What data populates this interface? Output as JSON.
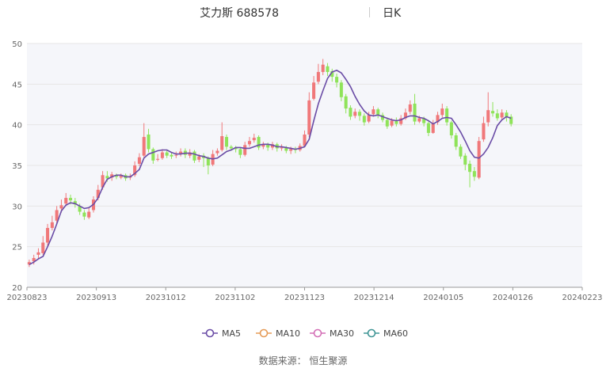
{
  "header": {
    "title": "艾力斯 688578",
    "period": "日K"
  },
  "source": "数据来源： 恒生聚源",
  "colors": {
    "up": "#f0787a",
    "down": "#8fe35a",
    "ma5": "#6a4ca6",
    "ma10": "#e59b57",
    "ma30": "#d36fb6",
    "ma60": "#3f9595",
    "plot_bg": "#f5f6fa",
    "grid": "#e6e6e6"
  },
  "chart_data": {
    "type": "candlestick",
    "title": "艾力斯 688578",
    "ylim": [
      20,
      50
    ],
    "yticks": [
      "20",
      "25",
      "30",
      "35",
      "40",
      "45",
      "50"
    ],
    "x_ticks": [
      "20230823",
      "20230913",
      "20231012",
      "20231102",
      "20231123",
      "20231214",
      "20240105",
      "20240126",
      "20240223"
    ],
    "n_days": 121,
    "legend": {
      "placement": "bottom",
      "entries": [
        "MA5",
        "MA10",
        "MA30",
        "MA60"
      ]
    },
    "candles": [
      [
        22.8,
        23.1,
        22.5,
        23.4
      ],
      [
        23.2,
        23.6,
        22.8,
        24.0
      ],
      [
        24.0,
        24.3,
        23.5,
        24.8
      ],
      [
        24.2,
        25.5,
        24.0,
        26.3
      ],
      [
        25.5,
        27.3,
        25.0,
        27.8
      ],
      [
        27.3,
        28.0,
        27.0,
        28.8
      ],
      [
        28.2,
        29.5,
        27.8,
        30.0
      ],
      [
        29.7,
        30.1,
        29.2,
        30.8
      ],
      [
        30.3,
        31.0,
        30.0,
        31.6
      ],
      [
        31.0,
        30.7,
        30.2,
        31.4
      ],
      [
        30.6,
        30.2,
        29.8,
        31.0
      ],
      [
        30.0,
        29.3,
        28.9,
        30.3
      ],
      [
        29.2,
        28.7,
        28.3,
        29.5
      ],
      [
        28.6,
        29.3,
        28.4,
        29.8
      ],
      [
        29.5,
        30.8,
        29.2,
        31.2
      ],
      [
        31.0,
        32.0,
        30.7,
        32.6
      ],
      [
        32.3,
        33.8,
        32.0,
        34.3
      ],
      [
        33.7,
        33.4,
        33.0,
        34.3
      ],
      [
        33.5,
        33.9,
        33.1,
        34.2
      ],
      [
        33.8,
        33.6,
        33.3,
        34.0
      ],
      [
        33.5,
        33.7,
        33.3,
        34.0
      ],
      [
        33.8,
        33.4,
        33.1,
        34.0
      ],
      [
        33.5,
        33.7,
        33.2,
        34.0
      ],
      [
        33.8,
        35.0,
        33.6,
        35.5
      ],
      [
        35.2,
        36.0,
        34.9,
        36.5
      ],
      [
        36.2,
        38.5,
        36.0,
        40.2
      ],
      [
        38.8,
        37.0,
        36.6,
        39.5
      ],
      [
        37.0,
        35.6,
        35.2,
        37.2
      ],
      [
        35.7,
        35.8,
        35.5,
        36.4
      ],
      [
        35.9,
        36.6,
        35.7,
        37.0
      ],
      [
        36.6,
        36.2,
        35.9,
        36.9
      ],
      [
        36.3,
        36.1,
        35.8,
        36.6
      ],
      [
        36.2,
        36.3,
        35.9,
        36.7
      ],
      [
        36.4,
        36.7,
        36.1,
        37.1
      ],
      [
        36.8,
        36.3,
        35.9,
        37.1
      ],
      [
        36.2,
        36.6,
        35.9,
        37.0
      ],
      [
        36.7,
        35.6,
        35.3,
        36.9
      ],
      [
        35.7,
        36.1,
        35.4,
        36.4
      ],
      [
        36.2,
        35.9,
        34.8,
        36.5
      ],
      [
        35.9,
        35.0,
        33.9,
        36.1
      ],
      [
        35.1,
        36.4,
        34.9,
        36.9
      ],
      [
        36.5,
        36.8,
        36.2,
        37.1
      ],
      [
        36.9,
        38.6,
        36.7,
        40.3
      ],
      [
        38.5,
        37.3,
        36.9,
        38.8
      ],
      [
        37.3,
        37.1,
        36.8,
        37.5
      ],
      [
        37.2,
        37.0,
        36.6,
        37.4
      ],
      [
        37.0,
        36.3,
        35.9,
        37.2
      ],
      [
        36.3,
        37.5,
        36.1,
        37.9
      ],
      [
        37.6,
        38.0,
        37.3,
        38.5
      ],
      [
        38.1,
        38.4,
        37.8,
        38.9
      ],
      [
        38.5,
        37.2,
        36.9,
        38.7
      ],
      [
        37.3,
        37.6,
        37.0,
        37.9
      ],
      [
        37.6,
        37.2,
        36.8,
        37.8
      ],
      [
        37.2,
        37.6,
        36.9,
        37.9
      ],
      [
        37.6,
        37.1,
        36.7,
        37.8
      ],
      [
        37.1,
        37.2,
        36.8,
        37.6
      ],
      [
        37.2,
        36.8,
        36.5,
        37.4
      ],
      [
        36.8,
        37.0,
        36.4,
        37.3
      ],
      [
        37.0,
        36.9,
        36.5,
        37.3
      ],
      [
        36.9,
        37.4,
        36.7,
        37.7
      ],
      [
        37.4,
        38.8,
        37.2,
        39.3
      ],
      [
        38.8,
        43.0,
        38.5,
        44.0
      ],
      [
        43.2,
        45.2,
        43.0,
        46.0
      ],
      [
        45.3,
        46.5,
        45.0,
        47.5
      ],
      [
        46.5,
        47.4,
        46.1,
        48.1
      ],
      [
        47.2,
        46.5,
        46.0,
        47.6
      ],
      [
        46.6,
        45.9,
        45.3,
        46.9
      ],
      [
        45.9,
        45.2,
        44.6,
        46.3
      ],
      [
        45.2,
        43.4,
        42.9,
        45.5
      ],
      [
        43.5,
        42.0,
        41.4,
        43.8
      ],
      [
        42.1,
        41.0,
        40.6,
        42.4
      ],
      [
        41.1,
        41.6,
        40.8,
        42.0
      ],
      [
        41.6,
        41.1,
        40.5,
        41.9
      ],
      [
        41.1,
        40.3,
        39.9,
        41.4
      ],
      [
        40.4,
        41.2,
        40.2,
        41.6
      ],
      [
        41.3,
        41.9,
        41.0,
        42.3
      ],
      [
        41.9,
        41.2,
        40.8,
        42.1
      ],
      [
        41.2,
        40.6,
        40.3,
        41.5
      ],
      [
        40.6,
        39.8,
        39.5,
        40.9
      ],
      [
        39.9,
        40.5,
        39.7,
        40.8
      ],
      [
        40.5,
        40.1,
        39.8,
        40.9
      ],
      [
        40.1,
        40.8,
        39.9,
        41.2
      ],
      [
        40.8,
        41.5,
        40.6,
        42.0
      ],
      [
        41.6,
        42.5,
        41.3,
        43.0
      ],
      [
        42.6,
        40.4,
        40.0,
        43.8
      ],
      [
        40.4,
        40.8,
        40.2,
        41.1
      ],
      [
        40.8,
        40.2,
        39.8,
        41.0
      ],
      [
        40.2,
        39.0,
        38.6,
        40.4
      ],
      [
        39.0,
        40.2,
        38.9,
        40.6
      ],
      [
        40.3,
        41.2,
        40.0,
        41.6
      ],
      [
        41.2,
        42.0,
        40.9,
        42.6
      ],
      [
        42.0,
        40.3,
        39.9,
        42.3
      ],
      [
        40.3,
        38.7,
        38.3,
        40.5
      ],
      [
        38.7,
        37.3,
        36.9,
        39.0
      ],
      [
        37.3,
        36.1,
        35.8,
        37.6
      ],
      [
        36.2,
        35.1,
        34.4,
        36.5
      ],
      [
        35.2,
        34.2,
        32.3,
        35.6
      ],
      [
        34.3,
        33.6,
        33.1,
        34.8
      ],
      [
        33.5,
        38.0,
        33.3,
        38.5
      ],
      [
        38.2,
        40.2,
        37.9,
        41.0
      ],
      [
        40.3,
        41.8,
        39.8,
        44.0
      ],
      [
        41.7,
        41.4,
        41.0,
        42.8
      ],
      [
        41.4,
        40.8,
        40.5,
        41.9
      ],
      [
        40.9,
        41.5,
        40.6,
        41.9
      ],
      [
        41.5,
        40.9,
        40.4,
        41.8
      ],
      [
        41.0,
        40.1,
        39.8,
        41.3
      ]
    ],
    "ma": {
      "MA5": [
        22.8,
        23.1,
        23.5,
        23.8,
        25.0,
        26.3,
        27.8,
        29.4,
        30.1,
        30.4,
        30.3,
        30.0,
        29.7,
        29.8,
        30.2,
        31.0,
        32.3,
        33.3,
        33.6,
        33.8,
        33.8,
        33.6,
        33.6,
        34.0,
        34.5,
        35.9,
        36.4,
        36.6,
        36.8,
        36.9,
        36.9,
        36.6,
        36.4,
        36.4,
        36.5,
        36.5,
        36.4,
        36.2,
        36.1,
        35.9,
        35.8,
        35.9,
        36.3,
        36.7,
        36.9,
        37.2,
        37.2,
        37.1,
        37.1,
        37.3,
        37.5,
        37.6,
        37.6,
        37.5,
        37.3,
        37.3,
        37.2,
        37.1,
        37.0,
        37.1,
        37.3,
        38.2,
        40.5,
        42.6,
        44.2,
        45.7,
        46.5,
        46.7,
        46.4,
        45.6,
        44.7,
        43.5,
        42.5,
        41.7,
        41.2,
        41.1,
        41.2,
        41.0,
        40.8,
        40.6,
        40.5,
        40.6,
        40.9,
        41.1,
        41.1,
        40.9,
        40.8,
        40.5,
        40.1,
        40.4,
        40.8,
        40.9,
        40.8,
        40.0,
        39.1,
        38.0,
        36.8,
        36.0,
        35.9,
        36.4,
        37.2,
        38.4,
        39.9,
        40.6,
        41.0,
        40.8
      ]
    }
  }
}
